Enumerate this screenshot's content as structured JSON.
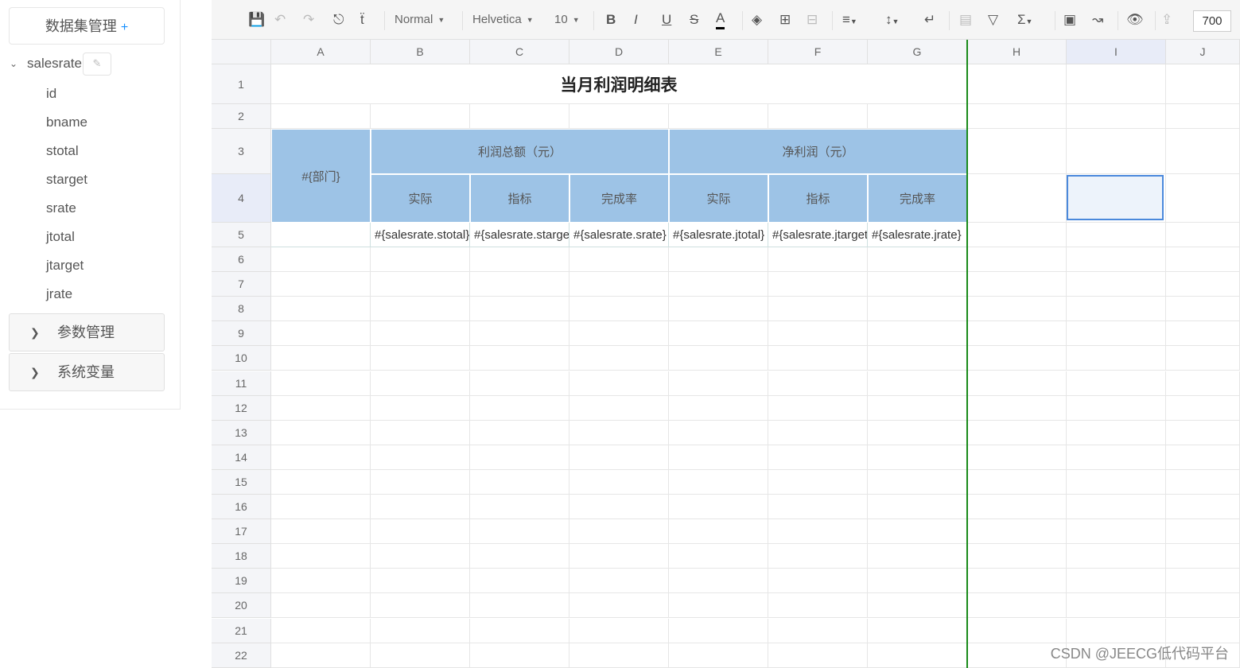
{
  "sidebar": {
    "dataset_title": "数据集管理",
    "dataset_add": "+",
    "dataset": {
      "name": "salesrate",
      "fields": [
        "id",
        "bname",
        "stotal",
        "starget",
        "srate",
        "jtotal",
        "jtarget",
        "jrate"
      ]
    },
    "sections": [
      {
        "label": "参数管理"
      },
      {
        "label": "系统变量"
      }
    ]
  },
  "toolbar": {
    "style": "Normal",
    "font": "Helvetica",
    "size": "10",
    "zoom": "700",
    "icons": [
      "save-icon",
      "undo-icon",
      "redo-icon",
      "paint-format-icon",
      "clear-format-icon",
      "bold-icon",
      "italic-icon",
      "underline-icon",
      "strikethrough-icon",
      "font-color-icon",
      "fill-color-icon",
      "border-icon",
      "merge-icon",
      "align-icon",
      "valign-icon",
      "wrap-icon",
      "table-icon",
      "filter-icon",
      "sum-icon",
      "image-icon",
      "chart-icon",
      "preview-icon",
      "export-icon"
    ]
  },
  "columns": [
    "A",
    "B",
    "C",
    "D",
    "E",
    "F",
    "G",
    "H",
    "I",
    "J"
  ],
  "rows": [
    "1",
    "2",
    "3",
    "4",
    "5",
    "6",
    "7",
    "8",
    "9",
    "10",
    "11",
    "12",
    "13",
    "14",
    "15",
    "16",
    "17",
    "18",
    "19",
    "20",
    "21",
    "22"
  ],
  "sheet": {
    "title": "当月利润明细表",
    "dept": "#{部门}",
    "group1": "利润总额（元）",
    "group2": "净利润（元）",
    "sub": [
      "实际",
      "指标",
      "完成率",
      "实际",
      "指标",
      "完成率"
    ],
    "values": [
      "#{salesrate.stotal}",
      "#{salesrate.starget}",
      "#{salesrate.srate}",
      "#{salesrate.jtotal}",
      "#{salesrate.jtarget}",
      "#{salesrate.jrate}"
    ],
    "header_color": "#9dc3e6",
    "selected_cell": "I4"
  },
  "watermark": "CSDN @JEECG低代码平台"
}
